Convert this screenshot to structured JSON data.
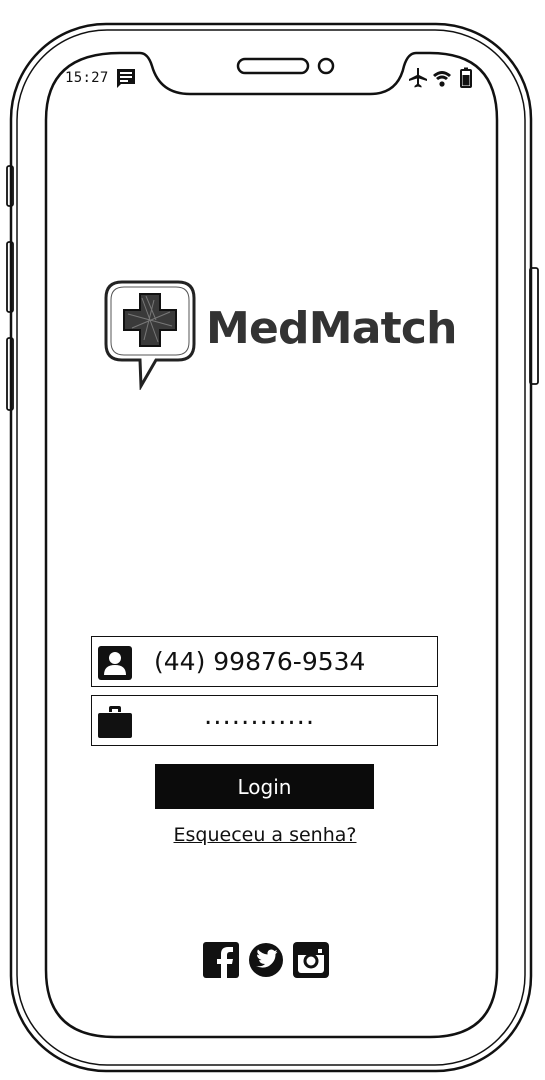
{
  "status_bar": {
    "time": "15:27",
    "left_icons": [
      "message-icon"
    ],
    "right_icons": [
      "airplane-icon",
      "wifi-icon",
      "battery-icon"
    ]
  },
  "logo": {
    "icon": "medical-cross-chat-icon",
    "text": "MedMatch"
  },
  "login_form": {
    "phone_icon": "user-card-icon",
    "phone_value": "(44) 99876-9534",
    "password_icon": "briefcase-icon",
    "password_value": "............",
    "login_label": "Login",
    "forgot_label": "Esqueceu a senha?"
  },
  "social": {
    "icons": [
      "facebook-icon",
      "twitter-icon",
      "instagram-icon"
    ]
  },
  "colors": {
    "ink": "#111111",
    "background": "#ffffff",
    "logo_text": "#333333"
  }
}
